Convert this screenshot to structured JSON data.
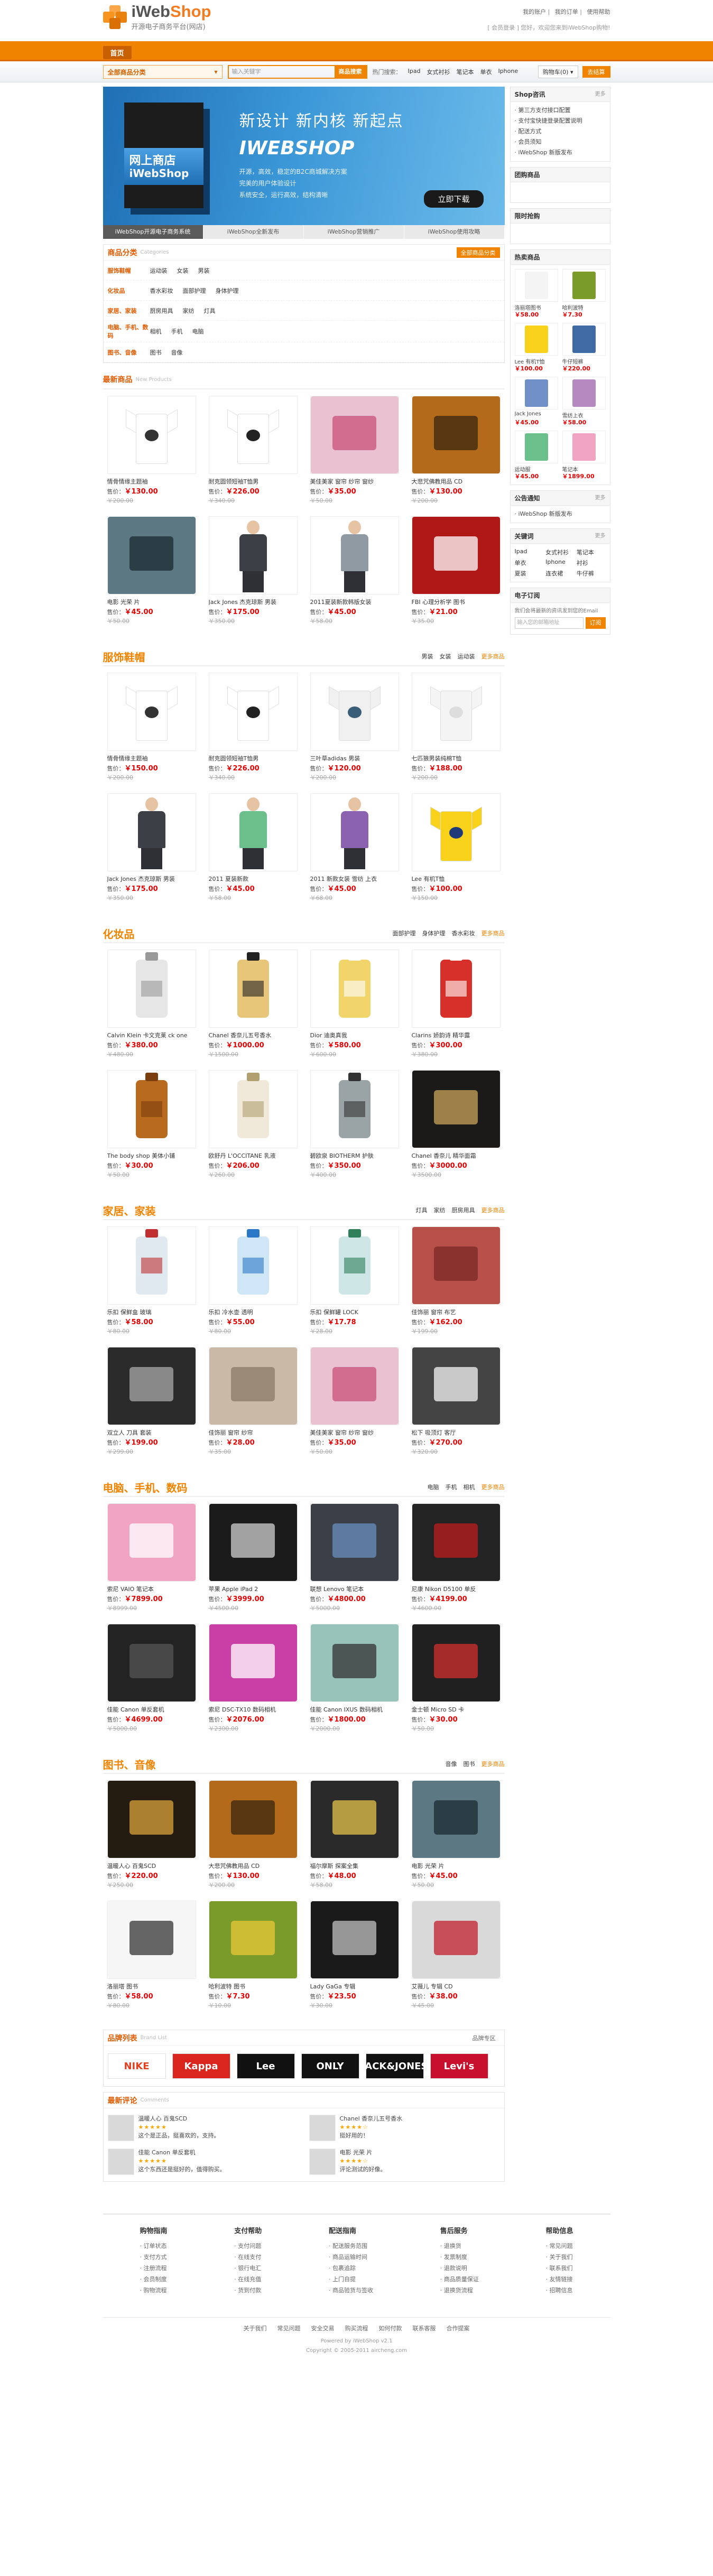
{
  "header": {
    "logo_main": "iWeb",
    "logo_accent": "Shop",
    "logo_sub": "开源电子商务平台(网店)",
    "toplinks": [
      "我的账户",
      "我的订单",
      "使用帮助"
    ],
    "welcome": "[ 会员登录 ] 您好，欢迎您来到iWebShop购物!"
  },
  "nav": {
    "home": "首页"
  },
  "searchbar": {
    "category": "全部商品分类",
    "placeholder": "输入关键字",
    "button": "商品搜索",
    "hotwords": [
      "热门搜索：",
      "Ipad",
      "女式衬衫",
      "笔记本",
      "单衣",
      "Iphone"
    ],
    "cart_text": "购物车(0) ▾",
    "cart_go": "去结算"
  },
  "banner": {
    "box_line1": "网上商店",
    "box_line2": "iWebShop",
    "headline": "新设计  新内核  新起点",
    "big": "IWEBSHOP",
    "bullets": [
      "开源，高效，稳定的B2C商城解决方案",
      "完美的用户体验设计",
      "系统安全，运行高效，结构清晰"
    ],
    "download": "立即下载",
    "tabs": [
      "iWebShop开源电子商务系统",
      "iWebShop全新发布",
      "iWebShop营销推广",
      "iWebShop使用攻略"
    ]
  },
  "category_panel": {
    "title": "商品分类",
    "en": "Categories",
    "all": "全部商品分类",
    "rows": [
      {
        "label": "服饰鞋帽",
        "items": [
          "运动装",
          "女装",
          "男装"
        ]
      },
      {
        "label": "化妆品",
        "items": [
          "香水彩妆",
          "面部护理",
          "身体护理"
        ]
      },
      {
        "label": "家居、家装",
        "items": [
          "厨房用具",
          "家纺",
          "灯具"
        ]
      },
      {
        "label": "电脑、手机、数码",
        "items": [
          "相机",
          "手机",
          "电脑"
        ]
      },
      {
        "label": "图书、音像",
        "items": [
          "图书",
          "音像"
        ]
      }
    ]
  },
  "sections": [
    {
      "title": "最新商品",
      "en": "New Products",
      "small": true,
      "tabs": [],
      "products": [
        {
          "name": "情骨情缘主题袖",
          "price": "￥130.00",
          "mkt": "￥200.00",
          "kind": "shirt",
          "c": "#ffffff",
          "p": "#333333"
        },
        {
          "name": "耐克圆领短袖T恤男",
          "price": "￥226.00",
          "mkt": "￥340.00",
          "kind": "shirt",
          "c": "#ffffff",
          "p": "#222222"
        },
        {
          "name": "美佳美家 窗帘 纱帘 窗纱",
          "price": "￥35.00",
          "mkt": "￥50.00",
          "kind": "block",
          "c": "#e9c1d0",
          "p": "#c8527a"
        },
        {
          "name": "大悲咒佛教用品 CD",
          "price": "￥130.00",
          "mkt": "￥200.00",
          "kind": "block",
          "c": "#b36b1b",
          "p": "#3a2410"
        },
        {
          "name": "电影 光荣 片",
          "price": "￥45.00",
          "mkt": "￥50.00",
          "kind": "block",
          "c": "#5c7883",
          "p": "#1b2a30"
        },
        {
          "name": "Jack Jones 杰克琼斯 男装",
          "price": "￥175.00",
          "mkt": "￥350.00",
          "kind": "person",
          "c": "#3c4046",
          "p": "#2f3035"
        },
        {
          "name": "2011夏装新款韩版女装",
          "price": "￥45.00",
          "mkt": "￥58.00",
          "kind": "person",
          "c": "#8f9aa2",
          "p": "#2f3035"
        },
        {
          "name": "FBI 心理分析学 图书",
          "price": "￥21.00",
          "mkt": "￥35.00",
          "kind": "block",
          "c": "#b01818",
          "p": "#ffffff"
        }
      ]
    },
    {
      "title": "服饰鞋帽",
      "en": "",
      "small": false,
      "tabs": [
        "男装",
        "女装",
        "运动装",
        "更多商品"
      ],
      "products": [
        {
          "name": "情骨情缘主题袖",
          "price": "￥150.00",
          "mkt": "￥200.00",
          "kind": "shirt",
          "c": "#ffffff",
          "p": "#333333"
        },
        {
          "name": "耐克圆领短袖T恤男",
          "price": "￥226.00",
          "mkt": "￥340.00",
          "kind": "shirt",
          "c": "#ffffff",
          "p": "#222222"
        },
        {
          "name": "三叶草adidas 男装",
          "price": "￥120.00",
          "mkt": "￥200.00",
          "kind": "shirt",
          "c": "#f0f0f0",
          "p": "#3b5e78"
        },
        {
          "name": "七匹狼男装纯棉T恤",
          "price": "￥188.00",
          "mkt": "￥200.00",
          "kind": "shirt",
          "c": "#f4f4f4",
          "p": "#dddddd"
        },
        {
          "name": "Jack Jones 杰克琼斯 男装",
          "price": "￥175.00",
          "mkt": "￥350.00",
          "kind": "person",
          "c": "#3c4046",
          "p": "#2f3035"
        },
        {
          "name": "2011 夏装新款",
          "price": "￥45.00",
          "mkt": "￥58.00",
          "kind": "person",
          "c": "#6bbf8a",
          "p": "#2f3035"
        },
        {
          "name": "2011 新款女装 雪纺 上衣",
          "price": "￥45.00",
          "mkt": "￥68.00",
          "kind": "person",
          "c": "#8a62b0",
          "p": "#2f3035"
        },
        {
          "name": "Lee 有机T恤",
          "price": "￥100.00",
          "mkt": "￥150.00",
          "kind": "shirt",
          "c": "#f8d21a",
          "p": "#1f3a7a"
        }
      ]
    },
    {
      "title": "化妆品",
      "en": "",
      "small": false,
      "tabs": [
        "面部护理",
        "身体护理",
        "香水彩妆",
        "更多商品"
      ],
      "products": [
        {
          "name": "Calvin Klein 卡文克莱 ck one",
          "price": "￥380.00",
          "mkt": "￥480.00",
          "kind": "bottle",
          "c": "#e6e6e6",
          "p": "#999999"
        },
        {
          "name": "Chanel 香奈儿五号香水",
          "price": "￥1000.00",
          "mkt": "￥1500.00",
          "kind": "bottle",
          "c": "#e8c679",
          "p": "#222222"
        },
        {
          "name": "Dior 迪奥真我",
          "price": "￥580.00",
          "mkt": "￥600.00",
          "kind": "bottle",
          "c": "#f1d46a",
          "p": "#ffffff"
        },
        {
          "name": "Clarins 娇韵诗 精华露",
          "price": "￥300.00",
          "mkt": "￥380.00",
          "kind": "bottle",
          "c": "#d7302a",
          "p": "#ffffff"
        },
        {
          "name": "The body shop 美体小铺",
          "price": "￥30.00",
          "mkt": "￥50.00",
          "kind": "bottle",
          "c": "#b86a1e",
          "p": "#7a3e0e"
        },
        {
          "name": "欧舒丹 L'OCCITANE 乳液",
          "price": "￥206.00",
          "mkt": "￥260.00",
          "kind": "bottle",
          "c": "#f0e8d8",
          "p": "#b0a070"
        },
        {
          "name": "碧欧泉 BIOTHERM 护肤",
          "price": "￥350.00",
          "mkt": "￥400.00",
          "kind": "bottle",
          "c": "#9aa4a6",
          "p": "#333333"
        },
        {
          "name": "Chanel 香奈儿 精华面霜",
          "price": "￥3000.00",
          "mkt": "￥3500.00",
          "kind": "block",
          "c": "#1c1a18",
          "p": "#c9a45a"
        }
      ]
    },
    {
      "title": "家居、家装",
      "en": "",
      "small": false,
      "tabs": [
        "灯具",
        "家纺",
        "厨房用具",
        "更多商品"
      ],
      "products": [
        {
          "name": "乐扣 保鲜盒 玻璃",
          "price": "￥58.00",
          "mkt": "￥80.00",
          "kind": "bottle",
          "c": "#dfe9ef",
          "p": "#c03030"
        },
        {
          "name": "乐扣 冷水壶 透明",
          "price": "￥55.00",
          "mkt": "￥80.00",
          "kind": "bottle",
          "c": "#cfe6f6",
          "p": "#2c78c8"
        },
        {
          "name": "乐扣 保鲜罐 LOCK",
          "price": "￥17.78",
          "mkt": "￥28.00",
          "kind": "bottle",
          "c": "#cfe6e6",
          "p": "#2f7f5a"
        },
        {
          "name": "佳饰丽 窗帘 布艺",
          "price": "￥162.00",
          "mkt": "￥199.00",
          "kind": "block",
          "c": "#b8504a",
          "p": "#7b2a26"
        },
        {
          "name": "双立人 刀具 套装",
          "price": "￥199.00",
          "mkt": "￥299.00",
          "kind": "block",
          "c": "#2b2b2b",
          "p": "#aaaaaa"
        },
        {
          "name": "佳饰丽 窗帘 纱帘",
          "price": "￥28.00",
          "mkt": "￥35.00",
          "kind": "block",
          "c": "#c9b9a6",
          "p": "#8a7a66"
        },
        {
          "name": "美佳美家 窗帘 纱帘 窗纱",
          "price": "￥35.00",
          "mkt": "￥50.00",
          "kind": "block",
          "c": "#e9c1d0",
          "p": "#c8527a"
        },
        {
          "name": "松下 吸顶灯 客厅",
          "price": "￥270.00",
          "mkt": "￥320.00",
          "kind": "block",
          "c": "#444444",
          "p": "#f4f4f4"
        }
      ]
    },
    {
      "title": "电脑、手机、数码",
      "en": "",
      "small": false,
      "tabs": [
        "电脑",
        "手机",
        "相机",
        "更多商品"
      ],
      "products": [
        {
          "name": "索尼 VAIO 笔记本",
          "price": "￥7899.00",
          "mkt": "￥8999.00",
          "kind": "block",
          "c": "#f1a3c2",
          "p": "#ffffff"
        },
        {
          "name": "苹果 Apple iPad 2",
          "price": "￥3999.00",
          "mkt": "￥4500.00",
          "kind": "block",
          "c": "#1b1b1b",
          "p": "#d0d0d0"
        },
        {
          "name": "联想 Lenovo 笔记本",
          "price": "￥4800.00",
          "mkt": "￥5000.00",
          "kind": "block",
          "c": "#3b4048",
          "p": "#6a8fbf"
        },
        {
          "name": "尼康 Nikon D5100 单反",
          "price": "￥4199.00",
          "mkt": "￥4600.00",
          "kind": "block",
          "c": "#232323",
          "p": "#bf1e1e"
        },
        {
          "name": "佳能 Canon 单反套机",
          "price": "￥4699.00",
          "mkt": "￥5000.00",
          "kind": "block",
          "c": "#232323",
          "p": "#555555"
        },
        {
          "name": "索尼 DSC-TX10 数码相机",
          "price": "￥2076.00",
          "mkt": "￥2300.00",
          "kind": "block",
          "c": "#c93fa6",
          "p": "#ffffff"
        },
        {
          "name": "佳能 Canon IXUS 数码相机",
          "price": "￥1800.00",
          "mkt": "￥2000.00",
          "kind": "block",
          "c": "#97c3bb",
          "p": "#333333"
        },
        {
          "name": "金士顿 Micro SD 卡",
          "price": "￥30.00",
          "mkt": "￥50.00",
          "kind": "block",
          "c": "#202020",
          "p": "#d22d2d"
        }
      ]
    },
    {
      "title": "图书、音像",
      "en": "",
      "small": false,
      "tabs": [
        "音像",
        "图书",
        "更多商品"
      ],
      "products": [
        {
          "name": "温暖人心 百鬼SCD",
          "price": "￥220.00",
          "mkt": "￥250.00",
          "kind": "block",
          "c": "#241c10",
          "p": "#d8a33a"
        },
        {
          "name": "大悲咒佛教用品 CD",
          "price": "￥130.00",
          "mkt": "￥200.00",
          "kind": "block",
          "c": "#b36b1b",
          "p": "#3a2410"
        },
        {
          "name": "福尔摩斯 探案全集",
          "price": "￥48.00",
          "mkt": "￥58.00",
          "kind": "block",
          "c": "#2a2a2a",
          "p": "#e4c24b"
        },
        {
          "name": "电影 光荣 片",
          "price": "￥45.00",
          "mkt": "￥50.00",
          "kind": "block",
          "c": "#5c7883",
          "p": "#1b2a30"
        },
        {
          "name": "洛丽塔 图书",
          "price": "￥58.00",
          "mkt": "￥80.00",
          "kind": "block",
          "c": "#f6f6f6",
          "p": "#333333"
        },
        {
          "name": "哈利波特 图书",
          "price": "￥7.30",
          "mkt": "￥10.00",
          "kind": "block",
          "c": "#7a9a2a",
          "p": "#e8c83a"
        },
        {
          "name": "Lady GaGa 专辑",
          "price": "￥23.50",
          "mkt": "￥30.00",
          "kind": "block",
          "c": "#1a1a1a",
          "p": "#c0c0c0"
        },
        {
          "name": "艾薇儿 专辑 CD",
          "price": "￥38.00",
          "mkt": "￥45.00",
          "kind": "block",
          "c": "#d9d9d9",
          "p": "#c01e2e"
        }
      ]
    }
  ],
  "brands": {
    "title": "品牌列表",
    "en": "Brand List",
    "more": "品牌专区",
    "items": [
      {
        "name": "NIKE",
        "c": "#e2401f",
        "bg": "#ffffff"
      },
      {
        "name": "Kappa",
        "c": "#ffffff",
        "bg": "#d9251e"
      },
      {
        "name": "Lee",
        "c": "#ffffff",
        "bg": "#111111"
      },
      {
        "name": "ONLY",
        "c": "#ffffff",
        "bg": "#111111"
      },
      {
        "name": "JACK&JONES",
        "c": "#ffffff",
        "bg": "#111111"
      },
      {
        "name": "Levi's",
        "c": "#ffffff",
        "bg": "#c8102e"
      }
    ]
  },
  "comments": {
    "title": "最新评论",
    "en": "Comments",
    "items": [
      {
        "product": "温暖人心 百鬼SCD",
        "stars": "★★★★★",
        "text": "这个是正品，挺喜欢的，支持。"
      },
      {
        "product": "Chanel 香奈儿五号香水",
        "stars": "★★★★☆",
        "text": "挺好用的！"
      },
      {
        "product": "佳能 Canon 单反套机",
        "stars": "★★★★★",
        "text": "这个东西还是挺好的，值得购买。"
      },
      {
        "product": "电影 光荣 片",
        "stars": "★★★★☆",
        "text": "评论测试的好像。"
      }
    ]
  },
  "sidebar": {
    "shop_news_title": "Shop咨讯",
    "more": "更多",
    "news": [
      "· 第三方支付接口配置",
      "· 支付宝快捷登录配置说明",
      "· 配送方式",
      "· 会员须知",
      "· iWebShop 新版发布"
    ],
    "group_title": "团购商品",
    "limit_title": "限时抢购",
    "hot_title": "热卖商品",
    "hot": [
      {
        "name": "洛丽塔图书",
        "price": "￥58.00",
        "c": "#f4f4f4"
      },
      {
        "name": "哈利波特",
        "price": "￥7.30",
        "c": "#7a9a2a"
      },
      {
        "name": "Lee 有机T恤",
        "price": "￥100.00",
        "c": "#f8d21a"
      },
      {
        "name": "牛仔短裤",
        "price": "￥220.00",
        "c": "#3f6aa4"
      },
      {
        "name": "Jack Jones",
        "price": "￥45.00",
        "c": "#6f8fc6"
      },
      {
        "name": "雪纺上衣",
        "price": "￥58.00",
        "c": "#b48ac0"
      },
      {
        "name": "运动服",
        "price": "￥45.00",
        "c": "#6bbf8a"
      },
      {
        "name": "笔记本",
        "price": "￥1899.00",
        "c": "#f1a3c2"
      }
    ],
    "notice_title": "公告通知",
    "notice": [
      "· iWebShop 新版发布"
    ],
    "keywords_title": "关键词",
    "keywords": [
      "Ipad",
      "女式衬衫",
      "笔记本",
      "单衣",
      "Iphone",
      "衬衫",
      "夏装",
      "连衣裙",
      "牛仔裤"
    ],
    "subscribe_title": "电子订阅",
    "subscribe_text": "我们会将最新的资讯发到您的Email",
    "subscribe_placeholder": "输入您的邮箱地址",
    "subscribe_button": "订阅"
  },
  "help": {
    "columns": [
      {
        "title": "购物指南",
        "items": [
          "订单状态",
          "支付方式",
          "注册流程",
          "会员制度",
          "购物流程"
        ]
      },
      {
        "title": "支付帮助",
        "items": [
          "支付问题",
          "在线支付",
          "银行电汇",
          "在线充值",
          "货到付款"
        ]
      },
      {
        "title": "配送指南",
        "items": [
          "配送服务范围",
          "商品运输时间",
          "包裹追踪",
          "上门自提",
          "商品验货与签收"
        ]
      },
      {
        "title": "售后服务",
        "items": [
          "退换货",
          "发票制度",
          "退款说明",
          "商品质量保证",
          "退换货流程"
        ]
      },
      {
        "title": "帮助信息",
        "items": [
          "常见问题",
          "关于我们",
          "联系我们",
          "友情链接",
          "招聘信息"
        ]
      }
    ]
  },
  "footer": {
    "links": [
      "关于我们",
      "常见问题",
      "安全交易",
      "购买流程",
      "如何付款",
      "联系客服",
      "合作提案"
    ],
    "powered": "Powered by iWebShop v2.1",
    "copyright": "Copyright © 2005-2011 aircheng.com"
  }
}
